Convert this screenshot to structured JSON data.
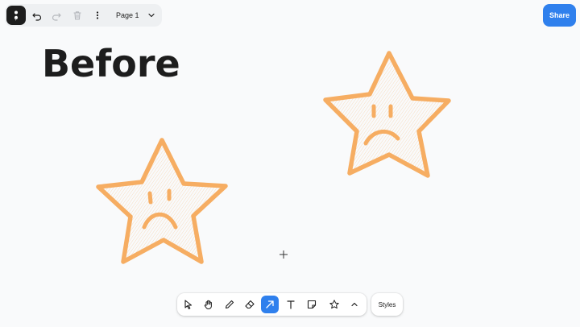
{
  "topbar": {
    "page_label": "Page 1",
    "icons": {
      "menu": "logo-menu-icon",
      "undo": "undo-icon",
      "redo": "redo-icon",
      "delete": "trash-icon",
      "more": "more-vertical-icon",
      "page_dropdown": "chevron-down-icon"
    }
  },
  "share_label": "Share",
  "canvas": {
    "heading": "Before",
    "stamp_color": "#f6ad62",
    "face_color": "#f6ad62"
  },
  "toolbar": {
    "tools": [
      "select",
      "hand",
      "draw",
      "eraser",
      "arrow",
      "text",
      "note",
      "shape",
      "more"
    ],
    "active_tool": "arrow"
  },
  "styles_label": "Styles",
  "colors": {
    "accent": "#2f80ed",
    "ink": "#1d1d1d",
    "background": "#f9fafb"
  }
}
